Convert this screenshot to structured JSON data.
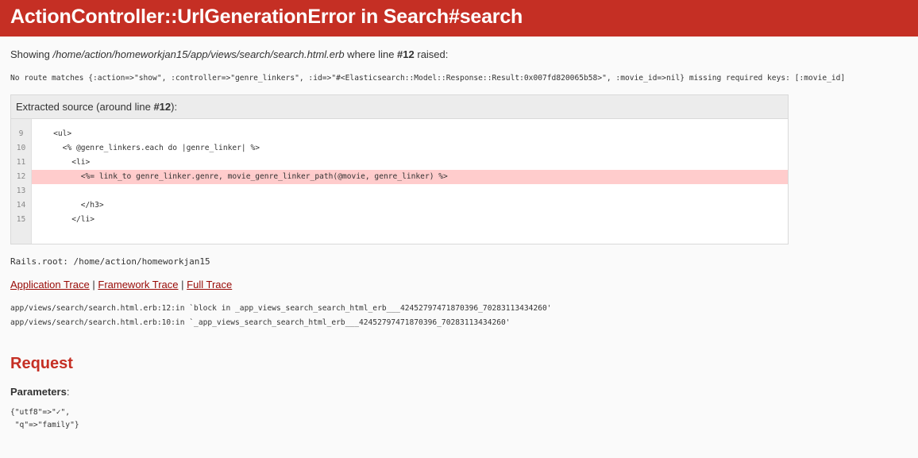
{
  "header": {
    "title": "ActionController::UrlGenerationError in Search#search"
  },
  "showing": {
    "prefix": "Showing ",
    "path": "/home/action/homeworkjan15/app/views/search/search.html.erb",
    "middle": " where line ",
    "line": "#12",
    "suffix": " raised:"
  },
  "message": "No route matches {:action=>\"show\", :controller=>\"genre_linkers\", :id=>\"#<Elasticsearch::Model::Response::Result:0x007fd820065b58>\", :movie_id=>nil} missing required keys: [:movie_id]",
  "source": {
    "title_prefix": "Extracted source (around line ",
    "title_line": "#12",
    "title_suffix": "):",
    "lines": [
      {
        "num": "9",
        "code": "    <ul>"
      },
      {
        "num": "10",
        "code": "      <% @genre_linkers.each do |genre_linker| %>"
      },
      {
        "num": "11",
        "code": "        <li>"
      },
      {
        "num": "12",
        "code": "          <%= link_to genre_linker.genre, movie_genre_linker_path(@movie, genre_linker) %>"
      },
      {
        "num": "13",
        "code": ""
      },
      {
        "num": "14",
        "code": "          </h3>"
      },
      {
        "num": "15",
        "code": "        </li>"
      }
    ],
    "highlight_line": "12"
  },
  "rails_root": "Rails.root: /home/action/homeworkjan15",
  "trace_links": {
    "application": "Application Trace",
    "framework": "Framework Trace",
    "full": "Full Trace",
    "separator": "|"
  },
  "trace_lines": [
    "app/views/search/search.html.erb:12:in `block in _app_views_search_search_html_erb___42452797471870396_70283113434260'",
    "app/views/search/search.html.erb:10:in `_app_views_search_search_html_erb___42452797471870396_70283113434260'"
  ],
  "request": {
    "heading": "Request",
    "params_label": "Parameters",
    "params_colon": ":",
    "params_line1": "{\"utf8\"=>\"✓\",",
    "params_line2": " \"q\"=>\"family\"}"
  },
  "colors": {
    "header_bg": "#c52f24",
    "highlight_bg": "#ffcccc",
    "link": "#980905"
  }
}
